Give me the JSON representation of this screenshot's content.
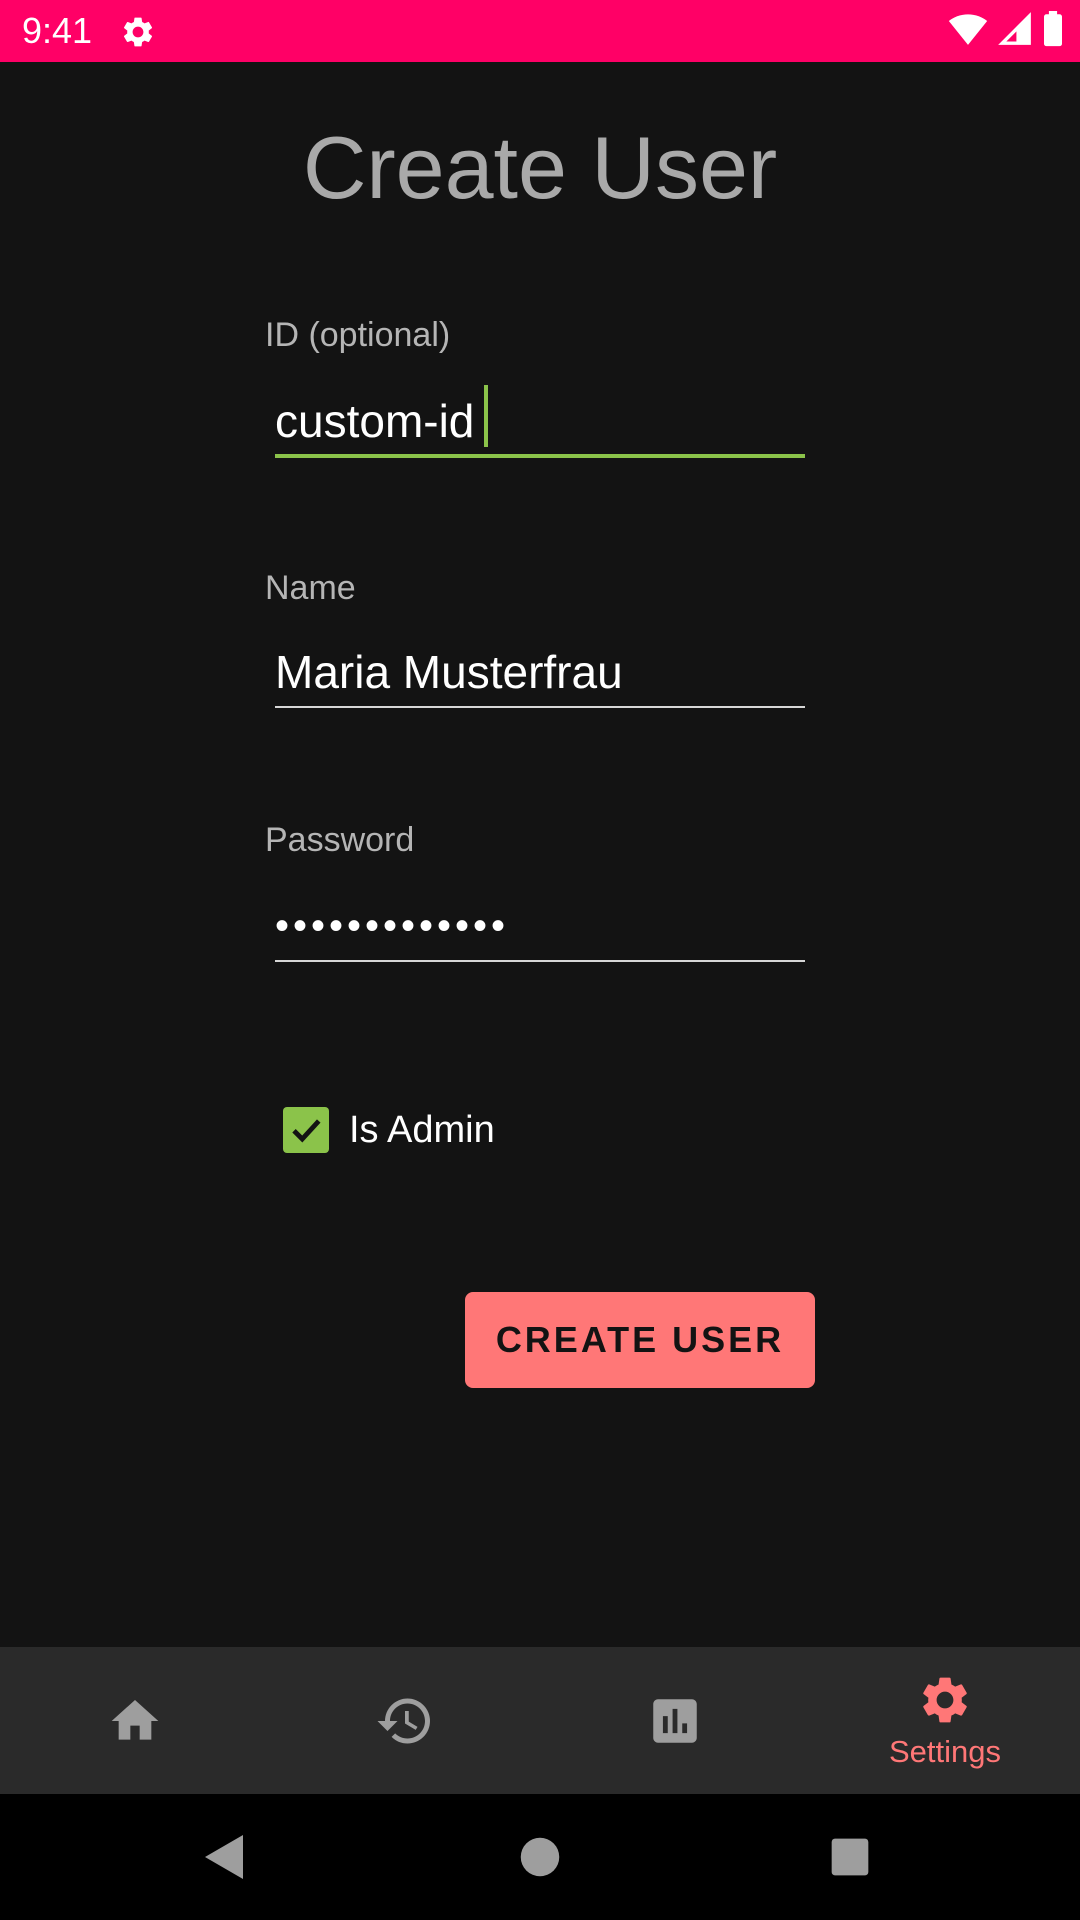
{
  "status_bar": {
    "time": "9:41",
    "background_color": "#ff0066",
    "icons": [
      "gear-icon",
      "wifi-icon",
      "cell-signal-icon",
      "battery-icon"
    ]
  },
  "page": {
    "title": "Create User"
  },
  "form": {
    "id_field": {
      "label": "ID (optional)",
      "value": "custom-id",
      "focused": true
    },
    "name_field": {
      "label": "Name",
      "value": "Maria Musterfrau"
    },
    "password_field": {
      "label": "Password",
      "value": "•••••••••••••"
    },
    "is_admin": {
      "label": "Is Admin",
      "checked": true
    },
    "submit_label": "CREATE USER"
  },
  "bottom_nav": {
    "items": [
      {
        "icon": "home-icon",
        "label": ""
      },
      {
        "icon": "history-icon",
        "label": ""
      },
      {
        "icon": "bar-chart-icon",
        "label": ""
      },
      {
        "icon": "settings-gear-icon",
        "label": "Settings",
        "active": true
      }
    ]
  },
  "system_nav": {
    "buttons": [
      "back-icon",
      "home-circle-icon",
      "recents-icon"
    ]
  },
  "colors": {
    "accent_green": "#8bc34a",
    "accent_coral": "#ff7777",
    "background": "#131313",
    "nav_background": "#2a2a2a",
    "inactive_icon": "#9e9e9e"
  }
}
